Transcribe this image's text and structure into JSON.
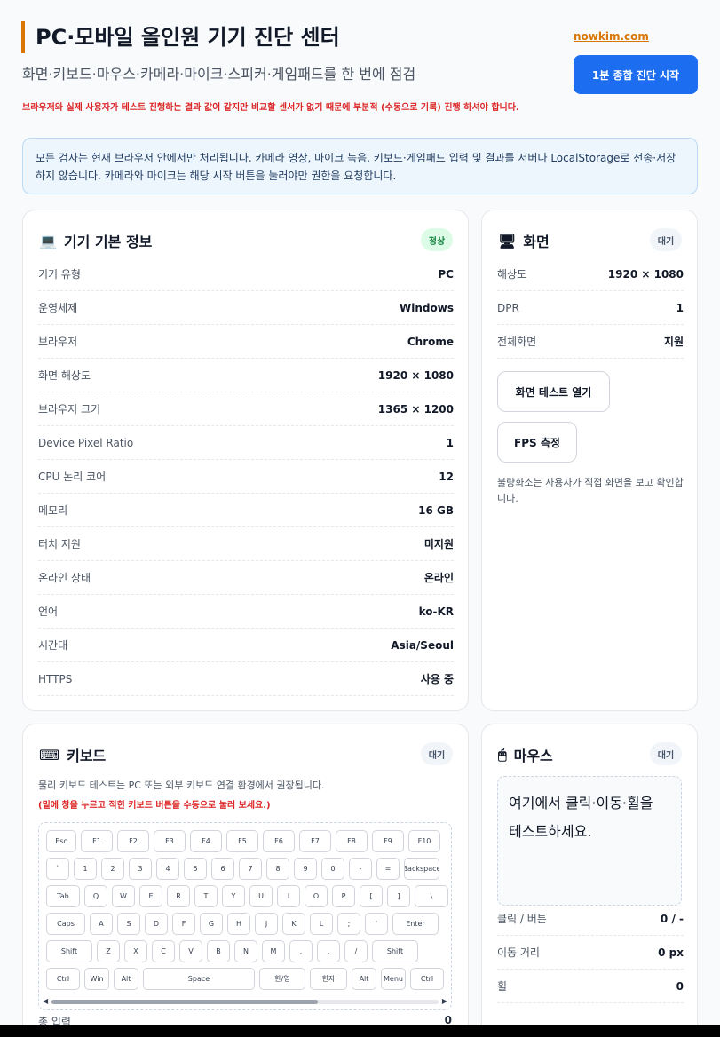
{
  "header": {
    "title": "PC·모바일 올인원 기기 진단 센터",
    "subtitle": "화면·키보드·마우스·카메라·마이크·스피커·게임패드를 한 번에 점검",
    "warning": "브라우저와 실제 사용자가 테스트 진행하는 결과 값이 같지만 비교할 센서가 없기 때문에 부분적 (수동으로 기록) 진행 하셔야 합니다.",
    "brand": "nowkim.com",
    "start_button": "1분 종합 진단 시작"
  },
  "notice": "모든 검사는 현재 브라우저 안에서만 처리됩니다. 카메라 영상, 마이크 녹음, 키보드·게임패드 입력 및 결과를 서버나 LocalStorage로 전송·저장하지 않습니다. 카메라와 마이크는 해당 시작 버튼을 눌러야만 권한을 요청합니다.",
  "device_info": {
    "icon": "💻",
    "title": "기기 기본 정보",
    "status": "정상",
    "rows": [
      {
        "k": "기기 유형",
        "v": "PC"
      },
      {
        "k": "운영체제",
        "v": "Windows"
      },
      {
        "k": "브라우저",
        "v": "Chrome"
      },
      {
        "k": "화면 해상도",
        "v": "1920 × 1080"
      },
      {
        "k": "브라우저 크기",
        "v": "1365 × 1200"
      },
      {
        "k": "Device Pixel Ratio",
        "v": "1"
      },
      {
        "k": "CPU 논리 코어",
        "v": "12"
      },
      {
        "k": "메모리",
        "v": "16 GB"
      },
      {
        "k": "터치 지원",
        "v": "미지원"
      },
      {
        "k": "온라인 상태",
        "v": "온라인"
      },
      {
        "k": "언어",
        "v": "ko-KR"
      },
      {
        "k": "시간대",
        "v": "Asia/Seoul"
      },
      {
        "k": "HTTPS",
        "v": "사용 중"
      }
    ]
  },
  "screen": {
    "icon": "🖥",
    "title": "화면",
    "status": "대기",
    "rows": [
      {
        "k": "해상도",
        "v": "1920 × 1080"
      },
      {
        "k": "DPR",
        "v": "1"
      },
      {
        "k": "전체화면",
        "v": "지원"
      }
    ],
    "open_test_button": "화면 테스트 열기",
    "fps_button": "FPS 측정",
    "hint": "불량화소는 사용자가 직접 화면을 보고 확인합니다."
  },
  "keyboard": {
    "icon": "⌨",
    "title": "키보드",
    "status": "대기",
    "note": "물리 키보드 테스트는 PC 또는 외부 키보드 연결 환경에서 권장됩니다.",
    "warning": "(밑에 창을 누르고 적힌 키보드 버튼을 수동으로 눌러 보세요.)",
    "rows": [
      [
        "Esc",
        "F1",
        "F2",
        "F3",
        "F4",
        "F5",
        "F6",
        "F7",
        "F8",
        "F9",
        "F10"
      ],
      [
        "`",
        "1",
        "2",
        "3",
        "4",
        "5",
        "6",
        "7",
        "8",
        "9",
        "0",
        "-",
        "=",
        "Backspace"
      ],
      [
        "Tab",
        "Q",
        "W",
        "E",
        "R",
        "T",
        "Y",
        "U",
        "I",
        "O",
        "P",
        "[",
        "]",
        "\\"
      ],
      [
        "Caps",
        "A",
        "S",
        "D",
        "F",
        "G",
        "H",
        "J",
        "K",
        "L",
        ";",
        "'",
        "Enter"
      ],
      [
        "Shift",
        "Z",
        "X",
        "C",
        "V",
        "B",
        "N",
        "M",
        ",",
        ".",
        "/",
        "Shift"
      ],
      [
        "Ctrl",
        "Win",
        "Alt",
        "Space",
        "한/영",
        "한자",
        "Alt",
        "Menu",
        "Ctrl"
      ]
    ],
    "total_label": "총 입력",
    "total_value": "0"
  },
  "mouse": {
    "icon": "🖱",
    "title": "마우스",
    "status": "대기",
    "area_text": "여기에서 클릭·이동·휠을 테스트하세요.",
    "rows": [
      {
        "k": "클릭 / 버튼",
        "v": "0 / -"
      },
      {
        "k": "이동 거리",
        "v": "0 px"
      },
      {
        "k": "휠",
        "v": "0"
      }
    ]
  }
}
